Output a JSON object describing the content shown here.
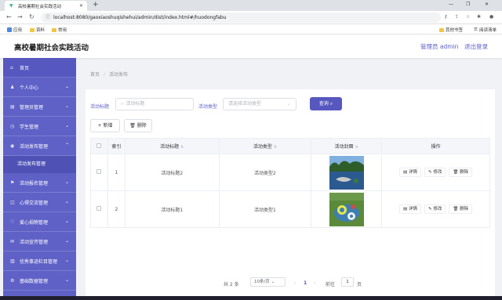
{
  "browser": {
    "tab_title": "高校暑期社会实践活动",
    "url": "localhost:8080/gaoxiaoshuqishehui/admin/dist/index.html#/huodongfabu",
    "bookmarks": [
      "应用",
      "资料",
      "常用"
    ],
    "other_bookmarks": "其他书签",
    "reading_list": "阅读清单"
  },
  "header": {
    "title": "高校暑期社会实践活动",
    "user": "管理员 admin",
    "logout": "退出登录"
  },
  "sidebar": {
    "items": [
      {
        "label": "首页"
      },
      {
        "label": "个人中心"
      },
      {
        "label": "管理员管理"
      },
      {
        "label": "学生管理"
      },
      {
        "label": "活动发布管理"
      },
      {
        "label": "活动报名管理"
      },
      {
        "label": "心得交流管理"
      },
      {
        "label": "爱心捐物管理"
      },
      {
        "label": "活动宣传管理"
      },
      {
        "label": "优秀事迹栏目管理"
      },
      {
        "label": "基础数据管理"
      }
    ],
    "active_sub": "活动发布管理"
  },
  "breadcrumb": {
    "home": "首页",
    "sep": "/",
    "current": "活动发布"
  },
  "filters": {
    "title_label": "活动标题",
    "title_placeholder": "活动标题",
    "type_label": "活动类型",
    "type_placeholder": "请选择活动类型",
    "search": "查询"
  },
  "actions": {
    "add": "+ 新增",
    "delete": "删除"
  },
  "table": {
    "headers": [
      "索引",
      "活动标题",
      "活动类型",
      "活动封面",
      "操作"
    ],
    "rows": [
      {
        "index": "1",
        "title": "活动标题2",
        "type": "活动类型2"
      },
      {
        "index": "2",
        "title": "活动标题1",
        "type": "活动类型1"
      }
    ],
    "ops": [
      "详情",
      "修改",
      "删除"
    ]
  },
  "pagination": {
    "total": "共 2 条",
    "page_size": "10条/页",
    "current": "1",
    "goto": "前往",
    "goto_value": "1",
    "page_unit": "页"
  },
  "colors": {
    "accent": "#5658bf",
    "sidebar": "#5f61c7"
  }
}
